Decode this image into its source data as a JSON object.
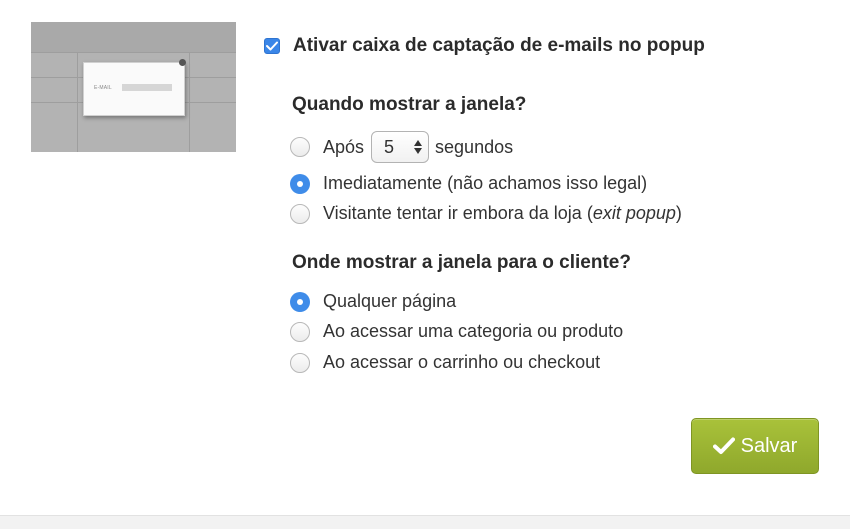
{
  "enable": {
    "label": "Ativar caixa de captação de e-mails no popup",
    "checked": true
  },
  "preview": {
    "field_label": "E-MAIL"
  },
  "when": {
    "heading": "Quando mostrar a janela?",
    "after_prefix": "Após",
    "after_seconds_value": "5",
    "after_suffix": "segundos",
    "immediately_label": "Imediatamente (não achamos isso legal)",
    "exit_label_prefix": "Visitante tentar ir embora da loja (",
    "exit_label_italic": "exit popup",
    "exit_label_suffix": ")",
    "selected": "immediately"
  },
  "where": {
    "heading": "Onde mostrar a janela para o cliente?",
    "options": [
      "Qualquer página",
      "Ao acessar uma categoria ou produto",
      "Ao acessar o carrinho ou checkout"
    ],
    "selected_index": 0
  },
  "actions": {
    "save_label": "Salvar"
  },
  "colors": {
    "accent_blue": "#3f8ce9",
    "save_green": "#9bb535"
  }
}
